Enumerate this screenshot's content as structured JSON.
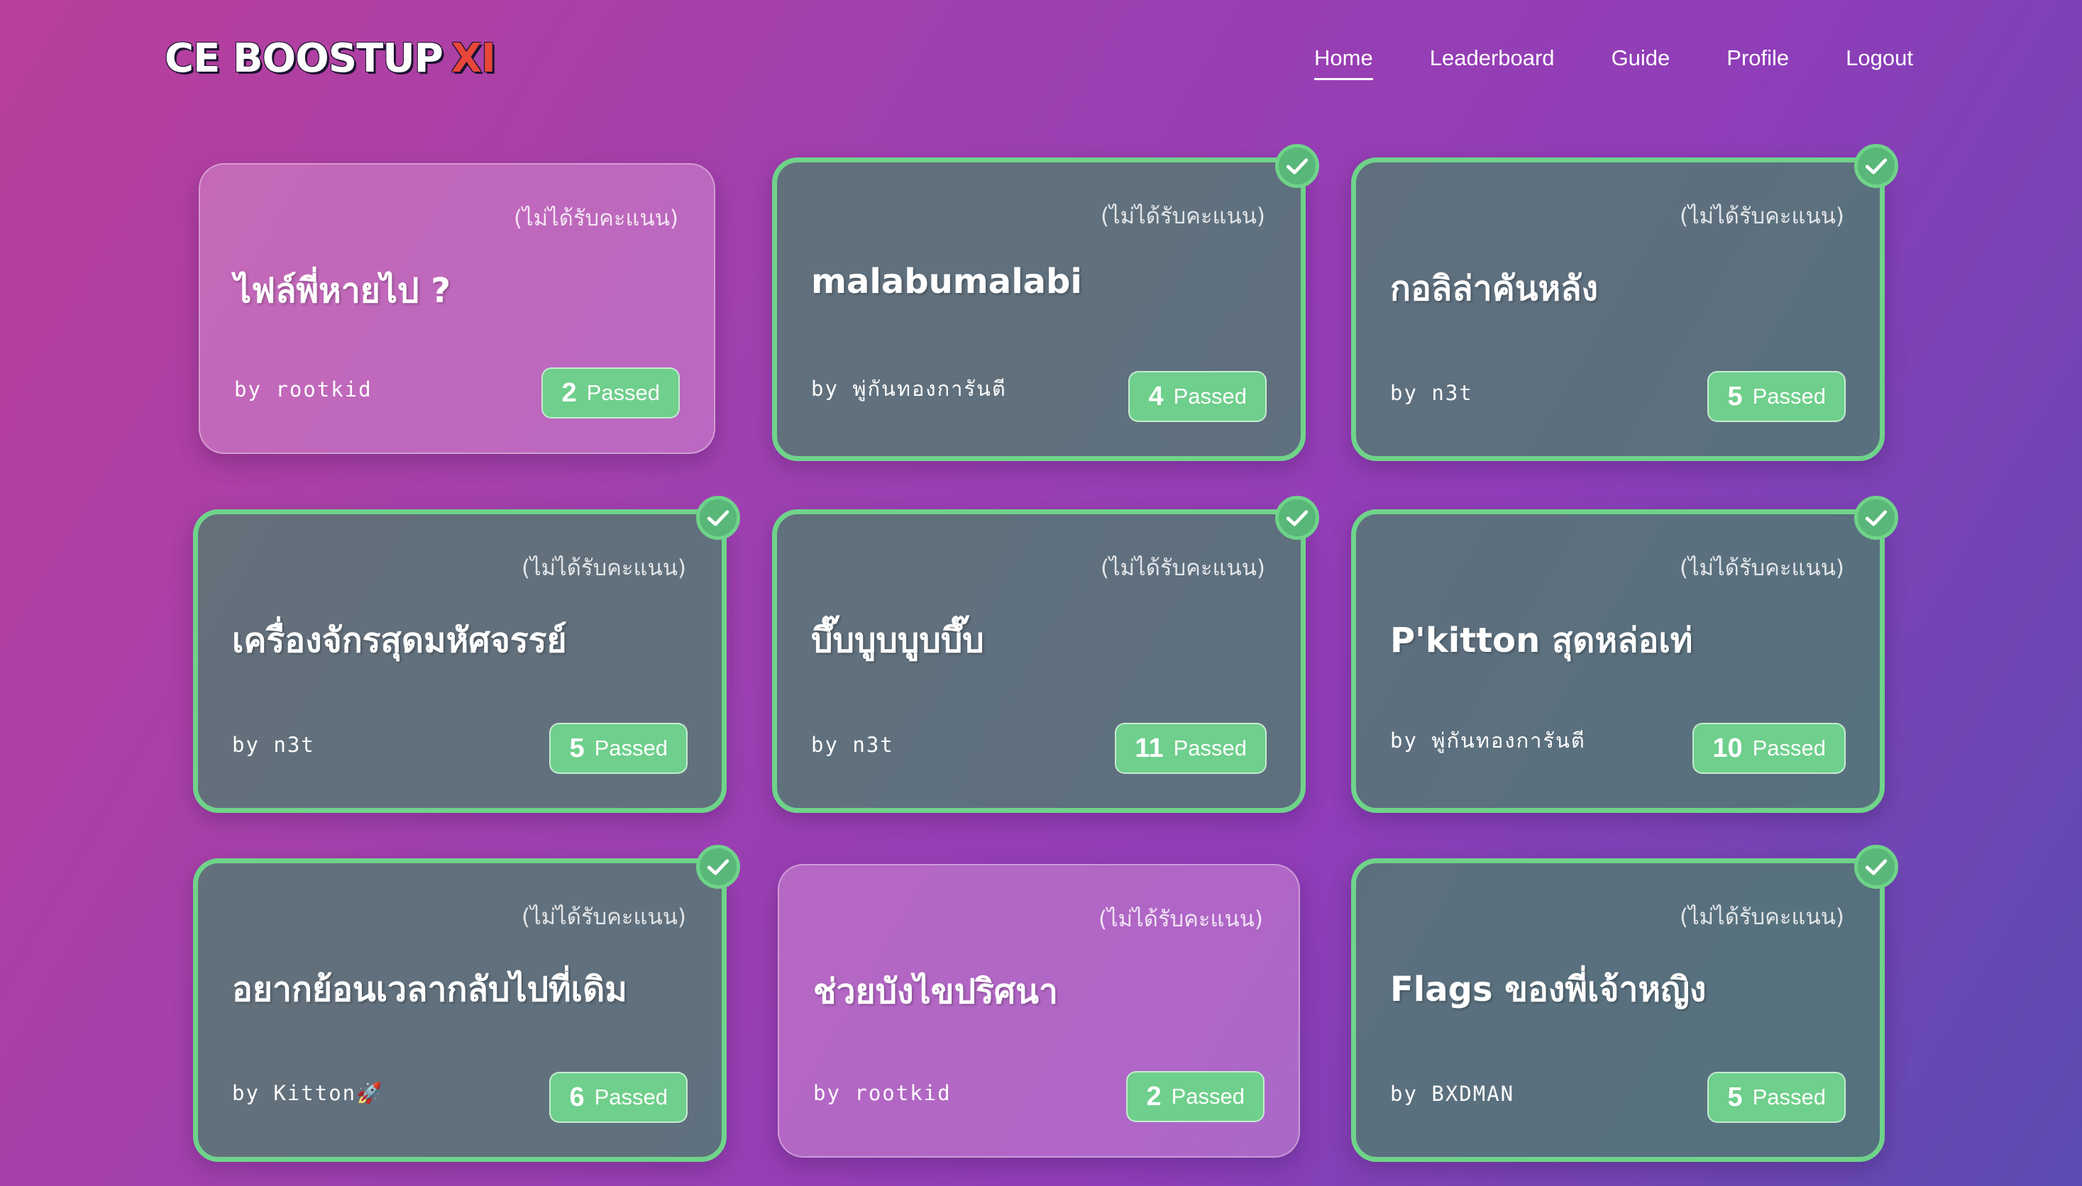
{
  "header": {
    "logo_main": "CE BOOSTUP",
    "logo_accent": "XI",
    "nav": [
      "Home",
      "Leaderboard",
      "Guide",
      "Profile",
      "Logout"
    ],
    "active_nav": "Home"
  },
  "colors": {
    "solved_border": "#6fd38a",
    "badge": "#6fcf8c",
    "logo_accent": "#e8463a"
  },
  "challenges": [
    {
      "note": "(ไม่ได้รับคะแนน)",
      "title": "ไฟล์พี่หายไป ?",
      "author": "by rootkid",
      "passed_count": "2",
      "passed_label": "Passed",
      "solved": false
    },
    {
      "note": "(ไม่ได้รับคะแนน)",
      "title": "malabumalabi",
      "author": "by พู่กันทองการันตี",
      "passed_count": "4",
      "passed_label": "Passed",
      "solved": true
    },
    {
      "note": "(ไม่ได้รับคะแนน)",
      "title": "กอลิล่าคันหลัง",
      "author": "by n3t",
      "passed_count": "5",
      "passed_label": "Passed",
      "solved": true
    },
    {
      "note": "(ไม่ได้รับคะแนน)",
      "title": "เครื่องจักรสุดมหัศจรรย์",
      "author": "by n3t",
      "passed_count": "5",
      "passed_label": "Passed",
      "solved": true
    },
    {
      "note": "(ไม่ได้รับคะแนน)",
      "title": "บึ๊บบูบบูบบึ๊บ",
      "author": "by n3t",
      "passed_count": "11",
      "passed_label": "Passed",
      "solved": true
    },
    {
      "note": "(ไม่ได้รับคะแนน)",
      "title": "P'kitton สุดหล่อเท่",
      "author": "by พู่กันทองการันตี",
      "passed_count": "10",
      "passed_label": "Passed",
      "solved": true
    },
    {
      "note": "(ไม่ได้รับคะแนน)",
      "title": "อยากย้อนเวลากลับไปที่เดิม",
      "author": "by Kitton🚀",
      "passed_count": "6",
      "passed_label": "Passed",
      "solved": true
    },
    {
      "note": "(ไม่ได้รับคะแนน)",
      "title": "ช่วยบังไขปริศนา",
      "author": "by rootkid",
      "passed_count": "2",
      "passed_label": "Passed",
      "solved": false
    },
    {
      "note": "(ไม่ได้รับคะแนน)",
      "title": "Flags ของพี่เจ้าหญิง",
      "author": "by BXDMAN",
      "passed_count": "5",
      "passed_label": "Passed",
      "solved": true
    }
  ]
}
